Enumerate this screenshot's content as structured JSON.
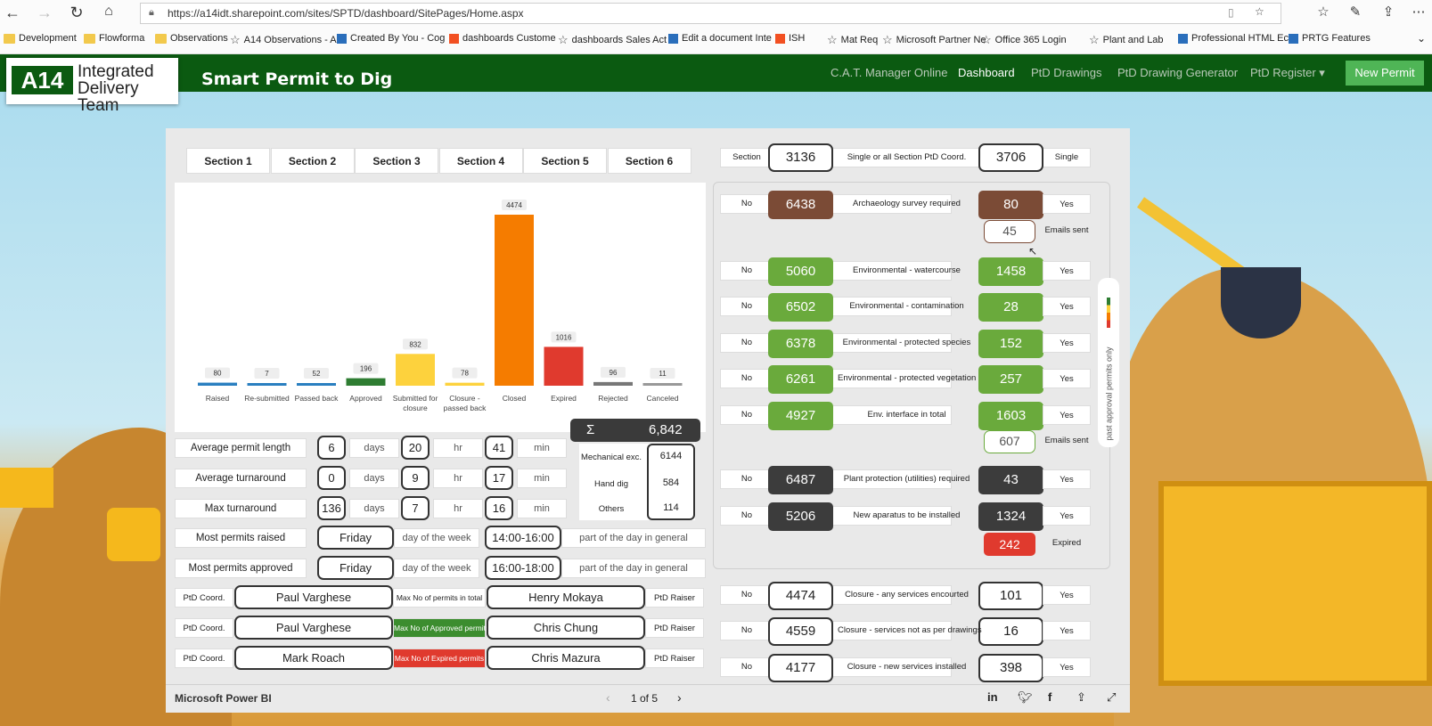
{
  "browser": {
    "url": "https://a14idt.sharepoint.com/sites/SPTD/dashboard/SitePages/Home.aspx",
    "bookmarks": [
      "Development",
      "Flowforma",
      "Observations",
      "A14 Observations - A",
      "Created By You - Cog",
      "dashboards Custome",
      "dashboards Sales Act",
      "Edit a document Inte",
      "ISH",
      "Mat Req",
      "Microsoft Partner Ne",
      "Office 365 Login",
      "Plant and Lab",
      "Professional HTML Ec",
      "PRTG Features"
    ]
  },
  "header": {
    "logo_short": "A14",
    "logo_line1": "Integrated",
    "logo_line2": "Delivery Team",
    "title": "Smart Permit to Dig",
    "nav": [
      "C.A.T. Manager Online",
      "Dashboard",
      "PtD Drawings",
      "PtD Drawing Generator",
      "PtD Register ▾"
    ],
    "new_permit": "New Permit"
  },
  "tabs": [
    "Section 1",
    "Section 2",
    "Section 3",
    "Section 4",
    "Section 5",
    "Section 6"
  ],
  "chart_data": {
    "type": "bar",
    "categories": [
      "Raised",
      "Re-submitted",
      "Passed back",
      "Approved",
      "Submitted for closure",
      "Closure - passed back",
      "Closed",
      "Expired",
      "Rejected",
      "Canceled"
    ],
    "values": [
      80,
      7,
      52,
      196,
      832,
      78,
      4474,
      1016,
      96,
      11
    ],
    "colors": [
      "#2a7fc0",
      "#2a7fc0",
      "#2a7fc0",
      "#2e7d32",
      "#fdd23d",
      "#fdd23d",
      "#f57c00",
      "#e03a2e",
      "#777777",
      "#999999"
    ]
  },
  "totals": {
    "sigma": "Σ",
    "total": "6,842",
    "mech_label": "Mechanical exc.",
    "mech": "6144",
    "hand_label": "Hand dig",
    "hand": "584",
    "others_label": "Others",
    "others": "114"
  },
  "stats": [
    {
      "label": "Average permit length",
      "d": "6",
      "h": "20",
      "m": "41"
    },
    {
      "label": "Average turnaround",
      "d": "0",
      "h": "9",
      "m": "17"
    },
    {
      "label": "Max turnaround",
      "d": "136",
      "h": "7",
      "m": "16"
    }
  ],
  "units": {
    "days": "days",
    "hr": "hr",
    "min": "min"
  },
  "most": [
    {
      "label": "Most permits raised",
      "day": "Friday",
      "day_unit": "day of the week",
      "time": "14:00-16:00",
      "time_unit": "part of the day in general"
    },
    {
      "label": "Most permits approved",
      "day": "Friday",
      "day_unit": "day of the week",
      "time": "16:00-18:00",
      "time_unit": "part of the day in general"
    }
  ],
  "people": [
    {
      "coord_label": "PtD Coord.",
      "coord": "Paul Varghese",
      "mid": "Max No of permits in total",
      "raiser": "Henry Mokaya",
      "raiser_label": "PtD Raiser"
    },
    {
      "coord_label": "PtD Coord.",
      "coord": "Paul Varghese",
      "mid": "Max No of Approved permits",
      "raiser": "Chris Chung",
      "raiser_label": "PtD Raiser"
    },
    {
      "coord_label": "PtD Coord.",
      "coord": "Mark Roach",
      "mid": "Max No of Expired permits",
      "raiser": "Chris Mazura",
      "raiser_label": "PtD Raiser"
    }
  ],
  "section_row": {
    "left_label": "Section",
    "left": "3136",
    "mid": "Single or all Section PtD Coord.",
    "right": "3706",
    "right_label": "Single"
  },
  "checks": [
    {
      "no": "No",
      "left": "6438",
      "mid": "Archaeology survey required",
      "right": "80",
      "yes": "Yes",
      "color": "#7b4b36"
    },
    {
      "no": "No",
      "left": "5060",
      "mid": "Environmental - watercourse",
      "right": "1458",
      "yes": "Yes",
      "color": "#6aaa3c"
    },
    {
      "no": "No",
      "left": "6502",
      "mid": "Environmental - contamination",
      "right": "28",
      "yes": "Yes",
      "color": "#6aaa3c"
    },
    {
      "no": "No",
      "left": "6378",
      "mid": "Environmental - protected species",
      "right": "152",
      "yes": "Yes",
      "color": "#6aaa3c"
    },
    {
      "no": "No",
      "left": "6261",
      "mid": "Environmental - protected vegetation",
      "right": "257",
      "yes": "Yes",
      "color": "#6aaa3c"
    },
    {
      "no": "No",
      "left": "4927",
      "mid": "Env. interface in total",
      "right": "1603",
      "yes": "Yes",
      "color": "#6aaa3c"
    },
    {
      "no": "No",
      "left": "6487",
      "mid": "Plant protection (utilities) required",
      "right": "43",
      "yes": "Yes",
      "color": "#3c3c3c"
    },
    {
      "no": "No",
      "left": "5206",
      "mid": "New aparatus to be installed",
      "right": "1324",
      "yes": "Yes",
      "color": "#3c3c3c"
    }
  ],
  "extras": {
    "arch_emails": "45",
    "emails_label": "Emails sent",
    "env_emails": "607",
    "expired": "242",
    "expired_label": "Expired"
  },
  "closure": [
    {
      "no": "No",
      "left": "4474",
      "mid": "Closure - any services encourted",
      "right": "101",
      "yes": "Yes"
    },
    {
      "no": "No",
      "left": "4559",
      "mid": "Closure - services not as per drawings",
      "right": "16",
      "yes": "Yes"
    },
    {
      "no": "No",
      "left": "4177",
      "mid": "Closure - new services installed",
      "right": "398",
      "yes": "Yes"
    }
  ],
  "side_label": "past approval permits only",
  "footer": {
    "brand": "Microsoft Power BI",
    "page": "1 of 5"
  }
}
